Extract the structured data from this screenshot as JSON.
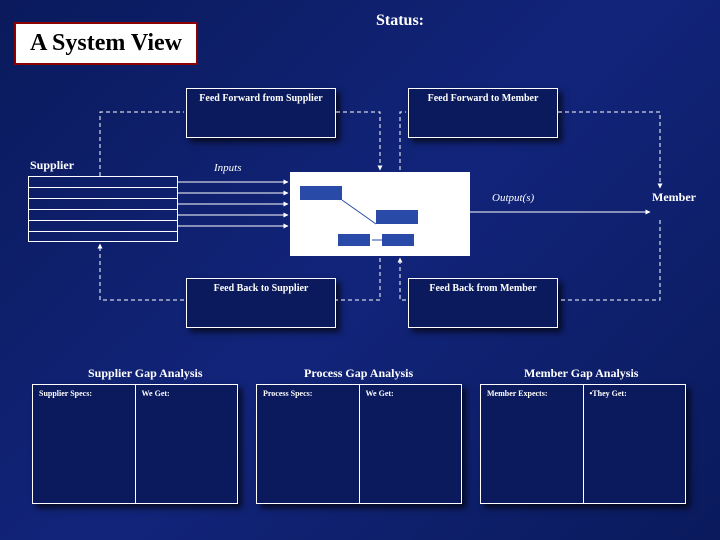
{
  "title": "A System View",
  "status_label": "Status:",
  "feed_forward_supplier": "Feed Forward from Supplier",
  "feed_forward_member": "Feed Forward to Member",
  "feed_back_supplier": "Feed Back to Supplier",
  "feed_back_member": "Feed Back from Member",
  "supplier_label": "Supplier",
  "inputs_label": "Inputs",
  "outputs_label": "Output(s)",
  "member_label": "Member",
  "gap": {
    "supplier": {
      "title": "Supplier Gap Analysis",
      "col1": "Supplier Specs:",
      "col2": "We Get:"
    },
    "process": {
      "title": "Process Gap Analysis",
      "col1": "Process Specs:",
      "col2": "We Get:"
    },
    "member": {
      "title": "Member Gap Analysis",
      "col1": "Member Expects:",
      "col2": "•They Get:"
    }
  }
}
